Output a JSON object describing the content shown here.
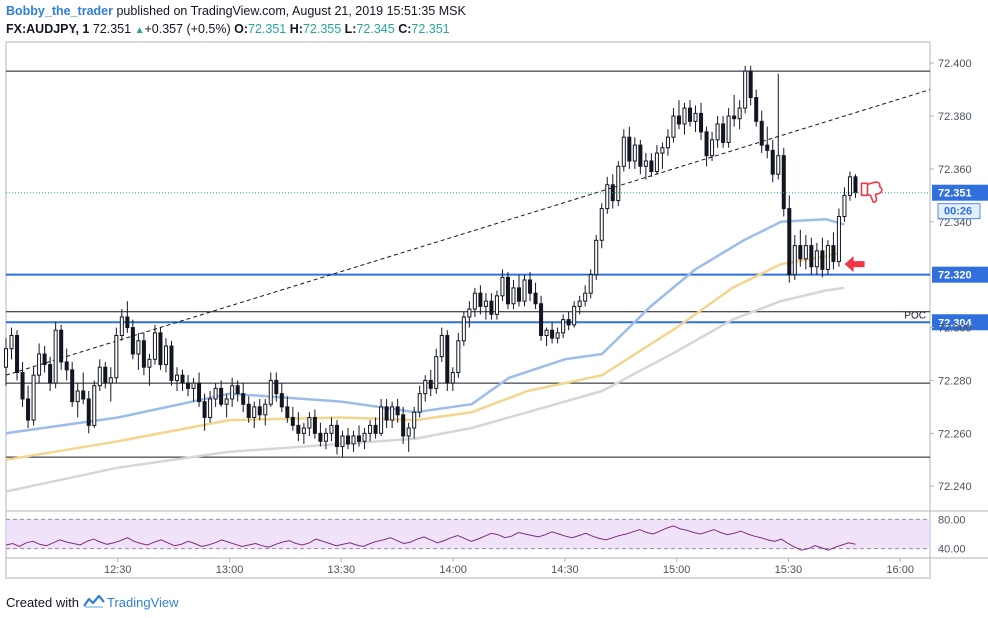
{
  "header": {
    "author": "Bobby_the_trader",
    "published_text": "published on TradingView.com, August 21, 2019 15:51:35 MSK",
    "symbol": "FX:AUDJPY, 1",
    "last": "72.351",
    "change_icon": "triangle-up-icon",
    "change": "+0.357 (+0.5%)",
    "o_label": "O:",
    "o_value": "72.351",
    "h_label": "H:",
    "h_value": "72.355",
    "l_label": "L:",
    "l_value": "72.345",
    "c_label": "C:",
    "c_value": "72.351"
  },
  "footer": {
    "created_with": "Created with",
    "brand": "TradingView",
    "logo_icon": "tradingview-logo-icon"
  },
  "colors": {
    "up": "#26a69a",
    "candle": "#131722",
    "blue_line": "#2f6fde",
    "ma_fast": "#9cbcea",
    "ma_mid": "#f3d58d",
    "ma_slow": "#d6d6d6",
    "rsi_fill": "#e9d7f7",
    "rsi_line": "#7e2c83",
    "price_tag": "#2f6fde",
    "annotation": "#f23645"
  },
  "chart_data": {
    "type": "candlestick",
    "title": "",
    "ylim": [
      72.231,
      72.408
    ],
    "y_ticks": [
      "72.400",
      "72.380",
      "72.360",
      "72.340",
      "72.300",
      "72.280",
      "72.260",
      "72.240"
    ],
    "x_ticks": [
      "12:30",
      "13:00",
      "13:30",
      "14:00",
      "14:30",
      "15:00",
      "15:30",
      "16:00"
    ],
    "x_tick_minutes": [
      750,
      780,
      810,
      840,
      870,
      900,
      930,
      960
    ],
    "x_range_minutes": [
      720,
      968
    ],
    "last_price_tag": "72.351",
    "countdown_tag": "00:26",
    "grid": false,
    "levels": [
      {
        "price": 72.397,
        "style": "black"
      },
      {
        "price": 72.32,
        "style": "blue",
        "label": "72.320"
      },
      {
        "price": 72.306,
        "style": "black"
      },
      {
        "price": 72.302,
        "style": "blue",
        "label": "72.304",
        "text": "POC"
      },
      {
        "price": 72.279,
        "style": "black"
      },
      {
        "price": 72.251,
        "style": "black"
      }
    ],
    "trendline": {
      "from": [
        720,
        72.282
      ],
      "to": [
        968,
        72.39
      ]
    },
    "candles": [
      [
        72.285,
        72.296,
        72.278,
        72.292
      ],
      [
        72.292,
        72.3,
        72.288,
        72.297
      ],
      [
        72.297,
        72.299,
        72.28,
        72.283
      ],
      [
        72.283,
        72.287,
        72.27,
        72.273
      ],
      [
        72.273,
        72.278,
        72.262,
        72.265
      ],
      [
        72.265,
        72.285,
        72.263,
        72.282
      ],
      [
        72.282,
        72.294,
        72.279,
        72.29
      ],
      [
        72.29,
        72.293,
        72.283,
        72.286
      ],
      [
        72.286,
        72.289,
        72.276,
        72.279
      ],
      [
        72.279,
        72.302,
        72.277,
        72.299
      ],
      [
        72.299,
        72.301,
        72.284,
        72.287
      ],
      [
        72.287,
        72.292,
        72.28,
        72.284
      ],
      [
        72.284,
        72.287,
        72.27,
        72.272
      ],
      [
        72.272,
        72.279,
        72.266,
        72.276
      ],
      [
        72.276,
        72.283,
        72.271,
        72.273
      ],
      [
        72.273,
        72.276,
        72.26,
        72.263
      ],
      [
        72.263,
        72.28,
        72.262,
        72.278
      ],
      [
        72.278,
        72.288,
        72.276,
        72.285
      ],
      [
        72.285,
        72.287,
        72.277,
        72.279
      ],
      [
        72.279,
        72.285,
        72.272,
        72.281
      ],
      [
        72.281,
        72.3,
        72.279,
        72.297
      ],
      [
        72.297,
        72.307,
        72.295,
        72.304
      ],
      [
        72.304,
        72.31,
        72.298,
        72.3
      ],
      [
        72.3,
        72.303,
        72.288,
        72.29
      ],
      [
        72.29,
        72.298,
        72.284,
        72.295
      ],
      [
        72.295,
        72.298,
        72.282,
        72.285
      ],
      [
        72.285,
        72.29,
        72.278,
        72.288
      ],
      [
        72.288,
        72.301,
        72.286,
        72.298
      ],
      [
        72.298,
        72.3,
        72.284,
        72.286
      ],
      [
        72.286,
        72.296,
        72.283,
        72.293
      ],
      [
        72.293,
        72.295,
        72.278,
        72.28
      ],
      [
        72.28,
        72.285,
        72.276,
        72.282
      ],
      [
        72.282,
        72.284,
        72.276,
        72.279
      ],
      [
        72.279,
        72.282,
        72.274,
        72.277
      ],
      [
        72.277,
        72.281,
        72.272,
        72.279
      ],
      [
        72.279,
        72.283,
        72.27,
        72.272
      ],
      [
        72.272,
        72.275,
        72.261,
        72.266
      ],
      [
        72.266,
        72.276,
        72.264,
        72.273
      ],
      [
        72.273,
        72.279,
        72.27,
        72.277
      ],
      [
        72.277,
        72.28,
        72.27,
        72.271
      ],
      [
        72.271,
        72.275,
        72.266,
        72.273
      ],
      [
        72.273,
        72.281,
        72.27,
        72.278
      ],
      [
        72.278,
        72.28,
        72.272,
        72.275
      ],
      [
        72.275,
        72.279,
        72.268,
        72.271
      ],
      [
        72.271,
        72.274,
        72.264,
        72.266
      ],
      [
        72.266,
        72.272,
        72.262,
        72.27
      ],
      [
        72.27,
        72.273,
        72.265,
        72.267
      ],
      [
        72.267,
        72.273,
        72.263,
        72.271
      ],
      [
        72.271,
        72.283,
        72.27,
        72.28
      ],
      [
        72.28,
        72.283,
        72.272,
        72.275
      ],
      [
        72.275,
        72.279,
        72.268,
        72.27
      ],
      [
        72.27,
        72.274,
        72.264,
        72.266
      ],
      [
        72.266,
        72.27,
        72.261,
        72.263
      ],
      [
        72.263,
        72.268,
        72.257,
        72.26
      ],
      [
        72.26,
        72.264,
        72.256,
        72.262
      ],
      [
        72.262,
        72.268,
        72.259,
        72.266
      ],
      [
        72.266,
        72.269,
        72.258,
        72.26
      ],
      [
        72.26,
        72.264,
        72.255,
        72.257
      ],
      [
        72.257,
        72.262,
        72.254,
        72.26
      ],
      [
        72.26,
        72.266,
        72.257,
        72.263
      ],
      [
        72.263,
        72.265,
        72.252,
        72.255
      ],
      [
        72.255,
        72.261,
        72.251,
        72.259
      ],
      [
        72.259,
        72.262,
        72.254,
        72.256
      ],
      [
        72.256,
        72.261,
        72.253,
        72.259
      ],
      [
        72.259,
        72.263,
        72.255,
        72.257
      ],
      [
        72.257,
        72.262,
        72.254,
        72.26
      ],
      [
        72.26,
        72.265,
        72.257,
        72.263
      ],
      [
        72.263,
        72.266,
        72.258,
        72.26
      ],
      [
        72.26,
        72.273,
        72.259,
        72.27
      ],
      [
        72.27,
        72.273,
        72.262,
        72.265
      ],
      [
        72.265,
        72.272,
        72.262,
        72.27
      ],
      [
        72.27,
        72.273,
        72.264,
        72.267
      ],
      [
        72.267,
        72.27,
        72.256,
        72.259
      ],
      [
        72.259,
        72.264,
        72.253,
        72.262
      ],
      [
        72.262,
        72.27,
        72.258,
        72.268
      ],
      [
        72.268,
        72.278,
        72.266,
        72.275
      ],
      [
        72.275,
        72.282,
        72.272,
        72.28
      ],
      [
        72.28,
        72.284,
        72.274,
        72.277
      ],
      [
        72.277,
        72.292,
        72.275,
        72.289
      ],
      [
        72.289,
        72.3,
        72.287,
        72.297
      ],
      [
        72.297,
        72.299,
        72.276,
        72.279
      ],
      [
        72.279,
        72.285,
        72.276,
        72.283
      ],
      [
        72.283,
        72.298,
        72.281,
        72.295
      ],
      [
        72.295,
        72.306,
        72.293,
        72.304
      ],
      [
        72.304,
        72.31,
        72.3,
        72.307
      ],
      [
        72.307,
        72.315,
        72.304,
        72.313
      ],
      [
        72.313,
        72.316,
        72.305,
        72.308
      ],
      [
        72.308,
        72.313,
        72.303,
        72.31
      ],
      [
        72.31,
        72.313,
        72.303,
        72.305
      ],
      [
        72.305,
        72.314,
        72.303,
        72.312
      ],
      [
        72.312,
        72.322,
        72.31,
        72.319
      ],
      [
        72.319,
        72.321,
        72.307,
        72.309
      ],
      [
        72.309,
        72.318,
        72.307,
        72.315
      ],
      [
        72.315,
        72.32,
        72.308,
        72.31
      ],
      [
        72.31,
        72.32,
        72.308,
        72.318
      ],
      [
        72.318,
        72.321,
        72.31,
        72.313
      ],
      [
        72.313,
        72.317,
        72.307,
        72.309
      ],
      [
        72.309,
        72.312,
        72.295,
        72.297
      ],
      [
        72.297,
        72.3,
        72.293,
        72.299
      ],
      [
        72.299,
        72.302,
        72.294,
        72.296
      ],
      [
        72.296,
        72.3,
        72.294,
        72.298
      ],
      [
        72.298,
        72.305,
        72.296,
        72.303
      ],
      [
        72.303,
        72.306,
        72.299,
        72.301
      ],
      [
        72.301,
        72.31,
        72.3,
        72.308
      ],
      [
        72.308,
        72.312,
        72.305,
        72.31
      ],
      [
        72.31,
        72.316,
        72.308,
        72.313
      ],
      [
        72.313,
        72.322,
        72.311,
        72.32
      ],
      [
        72.32,
        72.335,
        72.318,
        72.333
      ],
      [
        72.333,
        72.347,
        72.33,
        72.345
      ],
      [
        72.345,
        72.357,
        72.343,
        72.354
      ],
      [
        72.354,
        72.358,
        72.345,
        72.348
      ],
      [
        72.348,
        72.363,
        72.346,
        72.361
      ],
      [
        72.361,
        72.375,
        72.359,
        72.372
      ],
      [
        72.372,
        72.376,
        72.36,
        72.363
      ],
      [
        72.363,
        72.372,
        72.36,
        72.369
      ],
      [
        72.369,
        72.371,
        72.358,
        72.361
      ],
      [
        72.361,
        72.366,
        72.356,
        72.363
      ],
      [
        72.363,
        72.366,
        72.357,
        72.359
      ],
      [
        72.359,
        72.369,
        72.358,
        72.366
      ],
      [
        72.366,
        72.37,
        72.36,
        72.368
      ],
      [
        72.368,
        72.375,
        72.365,
        72.372
      ],
      [
        72.372,
        72.383,
        72.37,
        72.38
      ],
      [
        72.38,
        72.386,
        72.375,
        72.377
      ],
      [
        72.377,
        72.385,
        72.373,
        72.383
      ],
      [
        72.383,
        72.386,
        72.376,
        72.378
      ],
      [
        72.378,
        72.384,
        72.374,
        72.381
      ],
      [
        72.381,
        72.385,
        72.371,
        72.374
      ],
      [
        72.374,
        72.376,
        72.361,
        72.365
      ],
      [
        72.365,
        72.374,
        72.363,
        72.371
      ],
      [
        72.371,
        72.38,
        72.368,
        72.377
      ],
      [
        72.377,
        72.38,
        72.368,
        72.37
      ],
      [
        72.37,
        72.383,
        72.368,
        72.38
      ],
      [
        72.38,
        72.388,
        72.376,
        72.379
      ],
      [
        72.379,
        72.386,
        72.375,
        72.383
      ],
      [
        72.383,
        72.399,
        72.381,
        72.397
      ],
      [
        72.397,
        72.399,
        72.384,
        72.387
      ],
      [
        72.387,
        72.39,
        72.376,
        72.378
      ],
      [
        72.378,
        72.382,
        72.366,
        72.369
      ],
      [
        72.369,
        72.376,
        72.364,
        72.367
      ],
      [
        72.367,
        72.371,
        72.355,
        72.358
      ],
      [
        72.358,
        72.396,
        72.356,
        72.365
      ],
      [
        72.365,
        72.368,
        72.342,
        72.345
      ],
      [
        72.345,
        72.35,
        72.317,
        72.32
      ],
      [
        72.32,
        72.335,
        72.318,
        72.331
      ],
      [
        72.331,
        72.337,
        72.323,
        72.326
      ],
      [
        72.326,
        72.335,
        72.322,
        72.331
      ],
      [
        72.331,
        72.334,
        72.32,
        72.323
      ],
      [
        72.323,
        72.332,
        72.32,
        72.329
      ],
      [
        72.329,
        72.334,
        72.319,
        72.322
      ],
      [
        72.322,
        72.333,
        72.32,
        72.331
      ],
      [
        72.331,
        72.336,
        72.322,
        72.325
      ],
      [
        72.325,
        72.345,
        72.323,
        72.342
      ],
      [
        72.342,
        72.353,
        72.34,
        72.35
      ],
      [
        72.35,
        72.359,
        72.348,
        72.357
      ],
      [
        72.357,
        72.358,
        72.349,
        72.351
      ]
    ],
    "moving_averages": [
      {
        "color_key": "ma_fast",
        "points": [
          [
            720,
            72.26
          ],
          [
            750,
            72.266
          ],
          [
            780,
            72.275
          ],
          [
            810,
            72.272
          ],
          [
            830,
            72.268
          ],
          [
            845,
            72.271
          ],
          [
            855,
            72.281
          ],
          [
            870,
            72.288
          ],
          [
            880,
            72.29
          ],
          [
            893,
            72.308
          ],
          [
            905,
            72.322
          ],
          [
            918,
            72.333
          ],
          [
            928,
            72.34
          ],
          [
            940,
            72.341
          ],
          [
            945,
            72.339
          ]
        ]
      },
      {
        "color_key": "ma_mid",
        "points": [
          [
            720,
            72.25
          ],
          [
            750,
            72.257
          ],
          [
            780,
            72.265
          ],
          [
            810,
            72.266
          ],
          [
            830,
            72.265
          ],
          [
            845,
            72.268
          ],
          [
            860,
            72.276
          ],
          [
            880,
            72.282
          ],
          [
            900,
            72.3
          ],
          [
            915,
            72.315
          ],
          [
            928,
            72.324
          ],
          [
            940,
            72.327
          ],
          [
            943,
            72.328
          ]
        ]
      },
      {
        "color_key": "ma_slow",
        "points": [
          [
            720,
            72.238
          ],
          [
            750,
            72.247
          ],
          [
            780,
            72.253
          ],
          [
            810,
            72.256
          ],
          [
            830,
            72.258
          ],
          [
            845,
            72.262
          ],
          [
            860,
            72.268
          ],
          [
            880,
            72.276
          ],
          [
            900,
            72.291
          ],
          [
            915,
            72.303
          ],
          [
            928,
            72.31
          ],
          [
            940,
            72.314
          ],
          [
            945,
            72.315
          ]
        ]
      }
    ],
    "annotations": [
      {
        "type": "thumbs-down",
        "minute": 948,
        "price": 72.35,
        "icon": "thumbs-down-icon"
      },
      {
        "type": "arrow-left",
        "minute": 944,
        "price": 72.324,
        "icon": "arrow-left-icon"
      }
    ],
    "rsi": {
      "levels": [
        80,
        40
      ],
      "tick_labels": [
        "80.00",
        "40.00"
      ],
      "range": [
        30,
        90
      ],
      "band": [
        40,
        80
      ],
      "values": [
        45,
        47,
        43,
        48,
        50,
        46,
        44,
        48,
        52,
        49,
        47,
        45,
        50,
        53,
        49,
        46,
        48,
        51,
        55,
        50,
        47,
        45,
        49,
        52,
        48,
        44,
        46,
        50,
        47,
        43,
        45,
        48,
        52,
        49,
        46,
        43,
        45,
        47,
        44,
        42,
        46,
        49,
        51,
        47,
        45,
        48,
        53,
        50,
        47,
        44,
        46,
        48,
        45,
        43,
        47,
        50,
        52,
        55,
        51,
        47,
        49,
        53,
        56,
        52,
        48,
        51,
        55,
        58,
        54,
        50,
        53,
        57,
        61,
        59,
        55,
        57,
        62,
        60,
        58,
        56,
        59,
        63,
        60,
        57,
        55,
        58,
        61,
        57,
        54,
        52,
        55,
        58,
        60,
        63,
        66,
        62,
        60,
        64,
        68,
        71,
        67,
        65,
        62,
        60,
        63,
        66,
        62,
        59,
        61,
        64,
        60,
        57,
        55,
        52,
        50,
        53,
        47,
        42,
        38,
        40,
        44,
        41,
        38,
        42,
        45,
        48,
        46
      ]
    }
  }
}
